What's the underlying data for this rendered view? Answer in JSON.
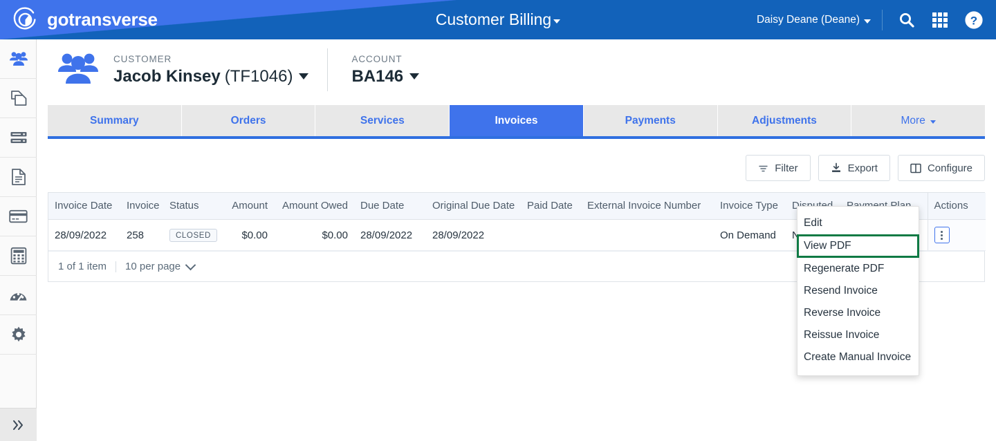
{
  "brand": {
    "name": "gotransverse",
    "logo_icon": "gotransverse-circle-logo"
  },
  "header": {
    "app_title": "Customer Billing",
    "app_title_caret_icon": "caret-down-icon",
    "user": "Daisy Deane (Deane)",
    "user_caret_icon": "caret-down-icon",
    "search_icon": "search-icon",
    "apps_icon": "apps-grid-icon",
    "help_icon": "help-circle-icon",
    "bg_color": "#1262ba",
    "accent_color": "#3f73eb"
  },
  "sidebar": {
    "items": [
      {
        "icon": "customers-people-icon",
        "name": "customers"
      },
      {
        "icon": "products-copy-icon",
        "name": "products"
      },
      {
        "icon": "servers-stack-icon",
        "name": "servers"
      },
      {
        "icon": "document-icon",
        "name": "documents"
      },
      {
        "icon": "credit-card-icon",
        "name": "billing"
      },
      {
        "icon": "calculator-icon",
        "name": "calculator"
      },
      {
        "icon": "dashboard-gauge-icon",
        "name": "dashboard"
      },
      {
        "icon": "gear-icon",
        "name": "settings"
      }
    ],
    "collapse_icon": "double-chevron-right-icon"
  },
  "context": {
    "customer_icon": "customers-people-icon",
    "customer_label": "CUSTOMER",
    "customer_name": "Jacob Kinsey",
    "customer_code": "(TF1046)",
    "account_label": "ACCOUNT",
    "account_value": "BA146"
  },
  "tabs": [
    {
      "label": "Summary",
      "active": false
    },
    {
      "label": "Orders",
      "active": false
    },
    {
      "label": "Services",
      "active": false
    },
    {
      "label": "Invoices",
      "active": true
    },
    {
      "label": "Payments",
      "active": false
    },
    {
      "label": "Adjustments",
      "active": false
    },
    {
      "label": "More",
      "active": false,
      "has_caret": true
    }
  ],
  "toolbar": {
    "filter_label": "Filter",
    "filter_icon": "filter-lines-icon",
    "export_label": "Export",
    "export_icon": "download-export-icon",
    "configure_label": "Configure",
    "configure_icon": "columns-configure-icon"
  },
  "table": {
    "columns": [
      "Invoice Date",
      "Invoice",
      "Status",
      "Amount",
      "Amount Owed",
      "Due Date",
      "Original Due Date",
      "Paid Date",
      "External Invoice Number",
      "Invoice Type",
      "Disputed",
      "Payment Plan",
      "Actions"
    ],
    "rows": [
      {
        "invoice_date": "28/09/2022",
        "invoice": "258",
        "status": "CLOSED",
        "amount": "$0.00",
        "amount_owed": "$0.00",
        "due_date": "28/09/2022",
        "original_due_date": "28/09/2022",
        "paid_date": "",
        "external_invoice_number": "",
        "invoice_type": "On Demand",
        "disputed": "No",
        "payment_plan": "",
        "actions_icon": "kebab-vertical-dots-icon"
      }
    ]
  },
  "pager": {
    "count_text": "1 of 1 item",
    "per_page_text": "10 per page",
    "chevron_icon": "chevron-down-icon"
  },
  "action_menu": {
    "items": [
      {
        "label": "Edit",
        "highlighted": false
      },
      {
        "label": "View PDF",
        "highlighted": true
      },
      {
        "label": "Regenerate PDF",
        "highlighted": false
      },
      {
        "label": "Resend Invoice",
        "highlighted": false
      },
      {
        "label": "Reverse Invoice",
        "highlighted": false
      },
      {
        "label": "Reissue Invoice",
        "highlighted": false
      },
      {
        "label": "Create Manual Invoice",
        "highlighted": false
      }
    ],
    "highlight_color": "#0f7a44"
  }
}
